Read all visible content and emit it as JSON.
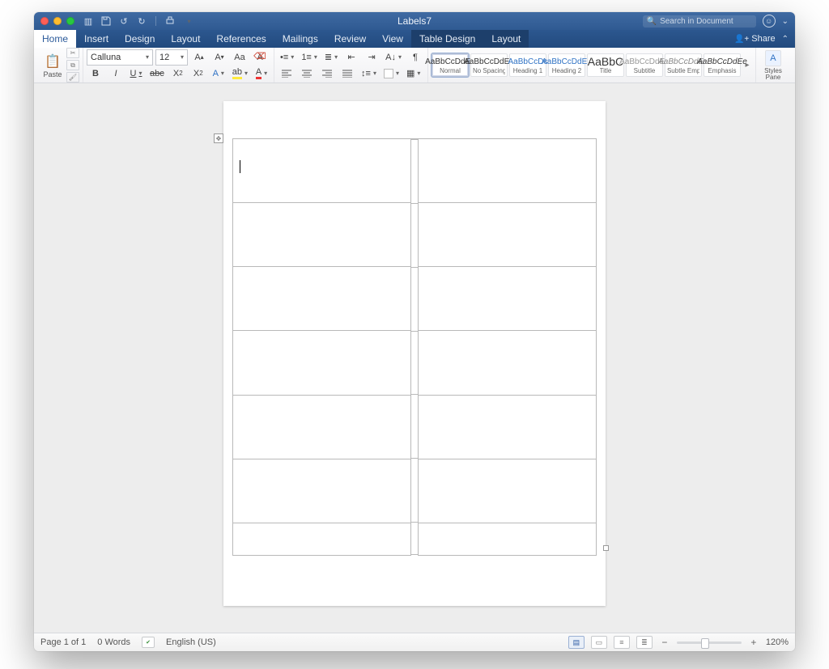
{
  "title": "Labels7",
  "search_placeholder": "Search in Document",
  "tabs": {
    "home": "Home",
    "insert": "Insert",
    "design": "Design",
    "layout": "Layout",
    "references": "References",
    "mailings": "Mailings",
    "review": "Review",
    "view": "View",
    "table_design": "Table Design",
    "table_layout": "Layout"
  },
  "tabs_right": {
    "share": "Share"
  },
  "ribbon": {
    "paste": "Paste",
    "font_name": "Calluna",
    "font_size": "12",
    "styles": [
      {
        "preview": "AaBbCcDdEe",
        "name": "Normal",
        "cls": "sel"
      },
      {
        "preview": "AaBbCcDdEe",
        "name": "No Spacing",
        "cls": ""
      },
      {
        "preview": "AaBbCcDc",
        "name": "Heading 1",
        "cls": "h1"
      },
      {
        "preview": "AaBbCcDdEe",
        "name": "Heading 2",
        "cls": "h2"
      },
      {
        "preview": "AaBbC",
        "name": "Title",
        "cls": "title"
      },
      {
        "preview": "AaBbCcDdEe",
        "name": "Subtitle",
        "cls": "subtle"
      },
      {
        "preview": "AaBbCcDdEe",
        "name": "Subtle Emph...",
        "cls": "subtleemph"
      },
      {
        "preview": "AaBbCcDdEe",
        "name": "Emphasis",
        "cls": "emph"
      }
    ],
    "styles_pane_label": "Styles\nPane"
  },
  "statusbar": {
    "page": "Page 1 of 1",
    "words": "0 Words",
    "language": "English (US)",
    "zoom": "120%"
  }
}
